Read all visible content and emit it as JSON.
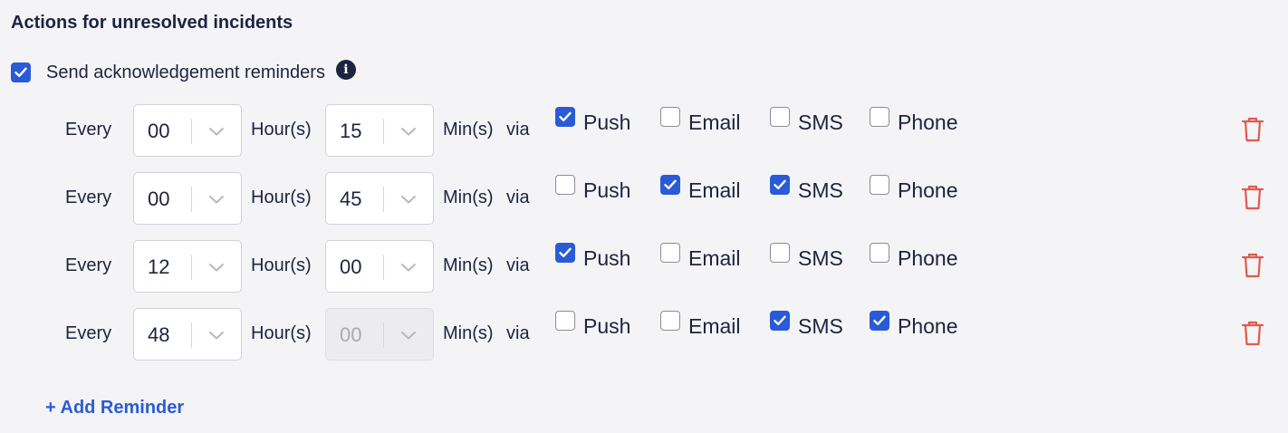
{
  "section": {
    "title": "Actions for unresolved incidents"
  },
  "master": {
    "label": "Send acknowledgement reminders",
    "checked": true,
    "info_icon": "info-icon"
  },
  "labels": {
    "every": "Every",
    "hours": "Hour(s)",
    "mins": "Min(s)",
    "via": "via"
  },
  "channels": {
    "push": "Push",
    "email": "Email",
    "sms": "SMS",
    "phone": "Phone"
  },
  "reminders": [
    {
      "hours": "00",
      "mins": "15",
      "mins_disabled": false,
      "push": true,
      "email": false,
      "sms": false,
      "phone": false
    },
    {
      "hours": "00",
      "mins": "45",
      "mins_disabled": false,
      "push": false,
      "email": true,
      "sms": true,
      "phone": false
    },
    {
      "hours": "12",
      "mins": "00",
      "mins_disabled": false,
      "push": true,
      "email": false,
      "sms": false,
      "phone": false
    },
    {
      "hours": "48",
      "mins": "00",
      "mins_disabled": true,
      "push": false,
      "email": false,
      "sms": true,
      "phone": true
    }
  ],
  "add_reminder": {
    "label": "+ Add Reminder"
  },
  "colors": {
    "accent": "#2a5bd7",
    "text": "#1d2340",
    "danger": "#e05a4e",
    "background": "#f4f4f6"
  }
}
